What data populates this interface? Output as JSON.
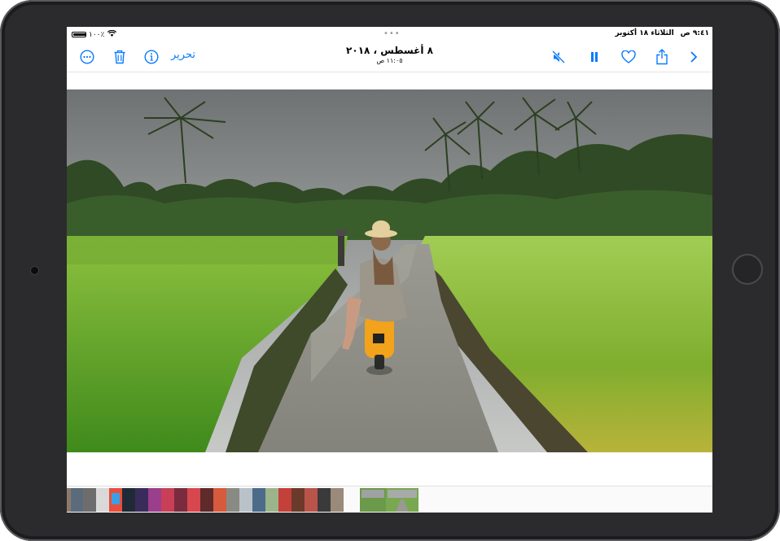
{
  "status_bar": {
    "time": "٩:٤١ ص",
    "date": "الثلاثاء ١٨ أكتوبر",
    "battery": "١٠٠٪"
  },
  "toolbar": {
    "edit_label": "تحرير",
    "title_date": "٨ أغسطس ، ٢٠١٨",
    "title_time": "١١:٠٥ ص"
  },
  "icons": {
    "more": "more-icon",
    "delete": "trash-icon",
    "info": "info-icon",
    "mute": "speaker-muted-icon",
    "pause": "pause-icon",
    "favorite": "heart-icon",
    "share": "share-icon",
    "next": "chevron-right-icon"
  },
  "colors": {
    "accent": "#0a7aff"
  }
}
